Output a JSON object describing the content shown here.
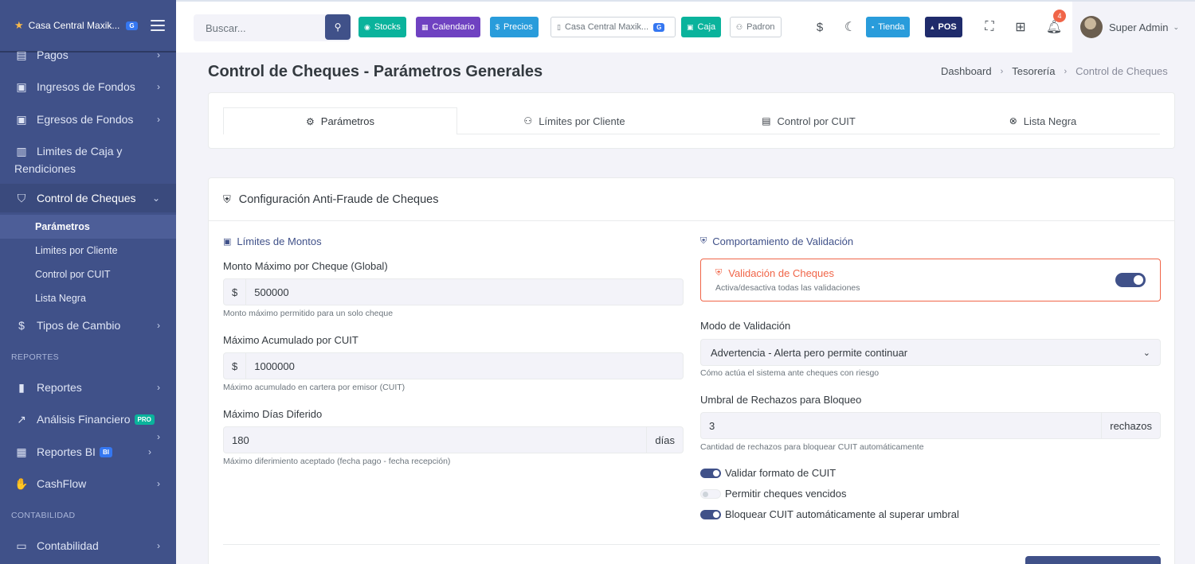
{
  "app": {
    "brand": "Casa Central Maxik...",
    "brand_badge": "G"
  },
  "sidebar": {
    "items": [
      {
        "label": "Pagos"
      },
      {
        "label": "Ingresos de Fondos"
      },
      {
        "label": "Egresos de Fondos"
      },
      {
        "label": "Limites de Caja y"
      },
      {
        "label": "Rendiciones"
      },
      {
        "label": "Control de Cheques"
      },
      {
        "label": "Tipos de Cambio"
      },
      {
        "label": "Reportes"
      },
      {
        "label": "Análisis Financiero"
      },
      {
        "label": "Reportes BI"
      },
      {
        "label": "CashFlow"
      },
      {
        "label": "Contabilidad"
      }
    ],
    "subitems": [
      {
        "label": "Parámetros"
      },
      {
        "label": "Limites por Cliente"
      },
      {
        "label": "Control por CUIT"
      },
      {
        "label": "Lista Negra"
      }
    ],
    "sections": {
      "reportes": "REPORTES",
      "contabilidad": "CONTABILIDAD"
    },
    "badges": {
      "pro": "PRO",
      "bi": "BI"
    }
  },
  "topbar": {
    "search_placeholder": "Buscar...",
    "buttons": {
      "stocks": "Stocks",
      "calendario": "Calendario",
      "precios": "Precios",
      "branch": "Casa Central Maxik...",
      "branch_badge": "G",
      "caja": "Caja",
      "padron": "Padron",
      "currency": "$",
      "tienda": "Tienda",
      "pos": "POS"
    },
    "notification_count": "4",
    "user_name": "Super Admin"
  },
  "page": {
    "title": "Control de Cheques - Parámetros Generales",
    "breadcrumb": [
      "Dashboard",
      "Tesorería",
      "Control de Cheques"
    ]
  },
  "tabs": [
    {
      "label": "Parámetros"
    },
    {
      "label": "Límites por Cliente"
    },
    {
      "label": "Control por CUIT"
    },
    {
      "label": "Lista Negra"
    }
  ],
  "config": {
    "title": "Configuración Anti-Fraude de Cheques",
    "limits": {
      "title": "Límites de Montos",
      "max_per_cheque": {
        "label": "Monto Máximo por Cheque (Global)",
        "prefix": "$",
        "value": "500000",
        "help": "Monto máximo permitido para un solo cheque"
      },
      "max_accum_cuit": {
        "label": "Máximo Acumulado por CUIT",
        "prefix": "$",
        "value": "1000000",
        "help": "Máximo acumulado en cartera por emisor (CUIT)"
      },
      "max_days": {
        "label": "Máximo Días Diferido",
        "value": "180",
        "suffix": "días",
        "help": "Máximo diferimiento aceptado (fecha pago - fecha recepción)"
      }
    },
    "behavior": {
      "title": "Comportamiento de Validación",
      "validation_toggle": {
        "title": "Validación de Cheques",
        "subtitle": "Activa/desactiva todas las validaciones",
        "on": true
      },
      "mode": {
        "label": "Modo de Validación",
        "value": "Advertencia - Alerta pero permite continuar",
        "help": "Cómo actúa el sistema ante cheques con riesgo"
      },
      "threshold": {
        "label": "Umbral de Rechazos para Bloqueo",
        "value": "3",
        "suffix": "rechazos",
        "help": "Cantidad de rechazos para bloquear CUIT automáticamente"
      },
      "switches": [
        {
          "label": "Validar formato de CUIT",
          "on": true
        },
        {
          "label": "Permitir cheques vencidos",
          "on": false
        },
        {
          "label": "Bloquear CUIT automáticamente al superar umbral",
          "on": true
        }
      ]
    }
  },
  "colors": {
    "sidebar": "#405189",
    "primary": "#405189",
    "stocks": "#0ab39c",
    "calendario": "#6f42c1",
    "precios": "#299cdb",
    "caja": "#0ab39c",
    "tienda": "#299cdb",
    "pos": "#1f2b6b",
    "danger": "#f06548"
  }
}
